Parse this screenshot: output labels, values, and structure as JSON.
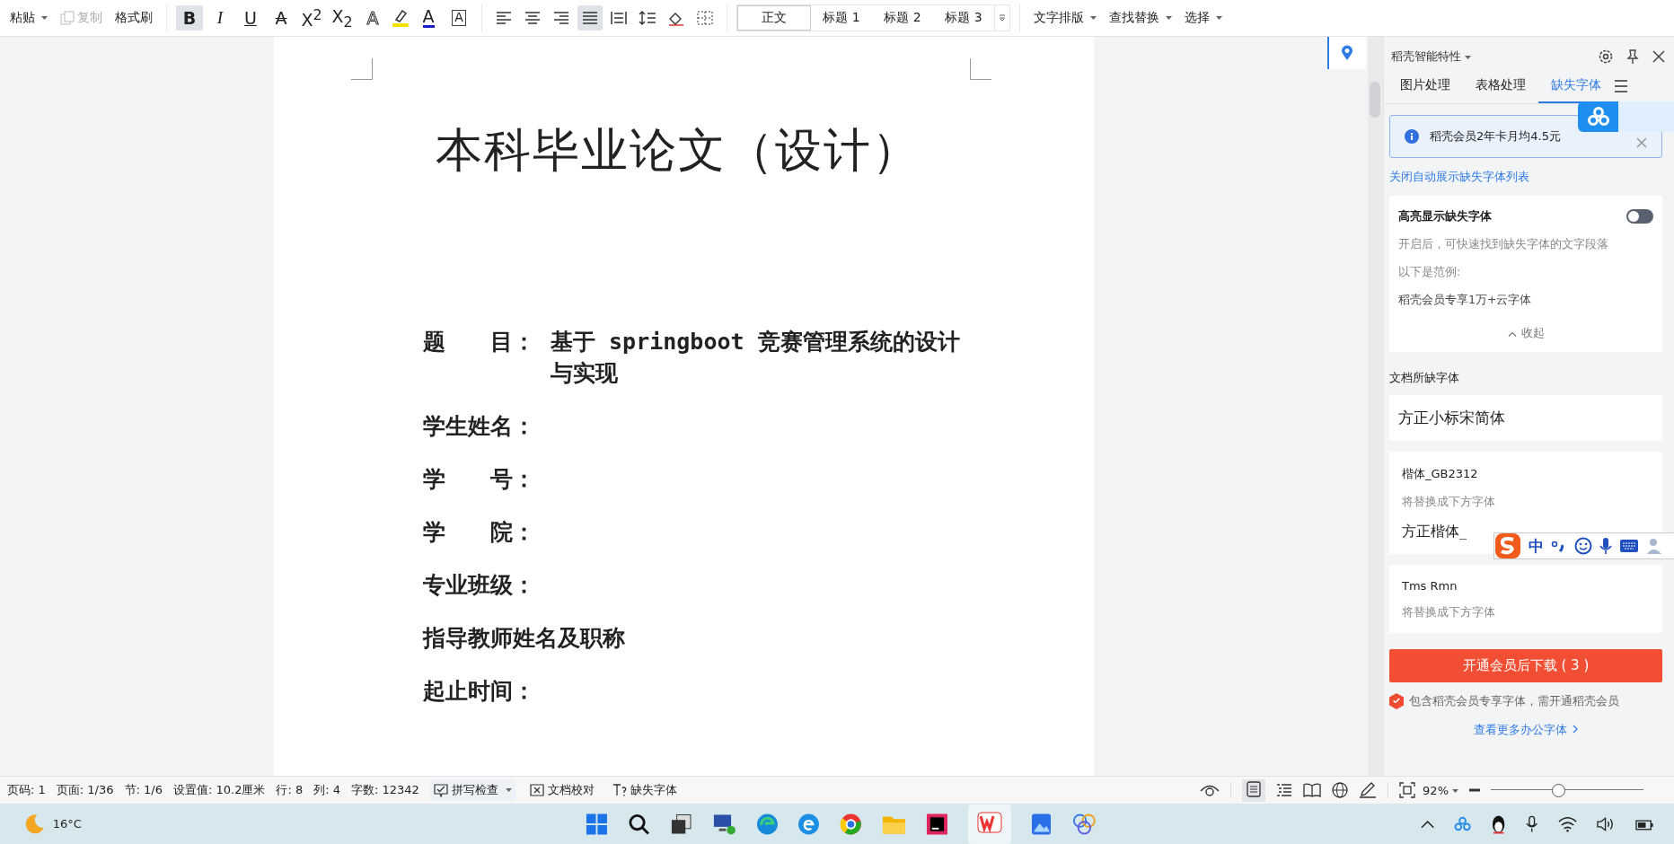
{
  "toolbar": {
    "clipboard": [
      {
        "label": "粘贴",
        "disabled": false,
        "dropdown": true
      },
      {
        "label": "复制",
        "disabled": true,
        "dropdown": false
      },
      {
        "label": "格式刷",
        "disabled": false,
        "dropdown": false
      }
    ],
    "format_buttons": [
      {
        "label": "B",
        "selected": true
      },
      {
        "label": "I",
        "selected": false
      },
      {
        "label": "U",
        "selected": false
      },
      {
        "label": "A",
        "selected": false
      },
      {
        "label": "X$^{2}$",
        "selected": false
      },
      {
        "label": "X$_{2}$",
        "selected": false
      },
      {
        "label": "A",
        "selected": false
      },
      {
        "label": "A",
        "selected": false
      },
      {
        "label": "A",
        "selected": false
      }
    ],
    "paragraph_buttons": [
      {
        "kind": "align-left",
        "selected": false
      },
      {
        "kind": "align-center",
        "selected": false
      },
      {
        "kind": "align-right",
        "selected": false
      },
      {
        "kind": "justify",
        "selected": true
      },
      {
        "kind": "distribute",
        "selected": false
      },
      {
        "kind": "line-spacing",
        "selected": false
      },
      {
        "kind": "shading",
        "selected": false
      },
      {
        "kind": "borders",
        "selected": false
      }
    ],
    "styles": [
      {
        "label": "正文",
        "selected": true
      },
      {
        "label": "标题 1",
        "selected": false
      },
      {
        "label": "标题 2",
        "selected": false
      },
      {
        "label": "标题 3",
        "selected": false
      }
    ],
    "menus": [
      "文字排版",
      "查找替换",
      "选择"
    ]
  },
  "document": {
    "title": "本科毕业论文（设计）",
    "fields": [
      {
        "label": "题　　目：",
        "value": "基于 springboot 竞赛管理系统的设计与实现"
      },
      {
        "label": "学生姓名："
      },
      {
        "label": "学　　号："
      },
      {
        "label": "学　　院："
      },
      {
        "label": "专业班级："
      },
      {
        "label": "指导教师姓名及职称"
      },
      {
        "label": "起止时间："
      }
    ]
  },
  "side_panel": {
    "title": "稻壳智能特性",
    "tabs": [
      {
        "label": "图片处理",
        "selected": false
      },
      {
        "label": "表格处理",
        "selected": false
      },
      {
        "label": "缺失字体",
        "selected": true
      }
    ],
    "banner": "稻壳会员2年卡月均4.5元",
    "auto_list_link": "关闭自动展示缺失字体列表",
    "highlight": {
      "title": "高亮显示缺失字体",
      "on": false,
      "lines": [
        "开启后，可快速找到缺失字体的文字段落",
        "以下是范例:"
      ],
      "sample": "稻壳会员专享1万+云字体",
      "collapse": "收起"
    },
    "section_title": "文档所缺字体",
    "missing_fonts": [
      {
        "kind": "preview",
        "name": "方正小标宋简体"
      },
      {
        "kind": "replace",
        "name": "楷体_GB2312",
        "hint": "将替换成下方字体",
        "replacement": "方正楷体_"
      },
      {
        "kind": "replace",
        "name": "Tms Rmn",
        "hint": "将替换成下方字体"
      }
    ],
    "download_button": "开通会员后下载 ( 3 )",
    "notice": "包含稻壳会员专享字体，需开通稻壳会员",
    "more_link": "查看更多办公字体"
  },
  "ime_toolbar": {
    "mode": "中"
  },
  "status_bar": {
    "items": [
      "页码: 1",
      "页面: 1/36",
      "节: 1/6",
      "设置值: 10.2厘米",
      "行: 8",
      "列: 4",
      "字数: 12342"
    ],
    "tools": [
      {
        "kind": "spell",
        "label": "拼写检查"
      },
      {
        "kind": "proof",
        "label": "文档校对"
      },
      {
        "kind": "font",
        "label": "缺失字体"
      }
    ],
    "zoom": "92%",
    "zoom_slider": {
      "level": 0.44
    }
  },
  "taskbar": {
    "weather": "16°C"
  }
}
